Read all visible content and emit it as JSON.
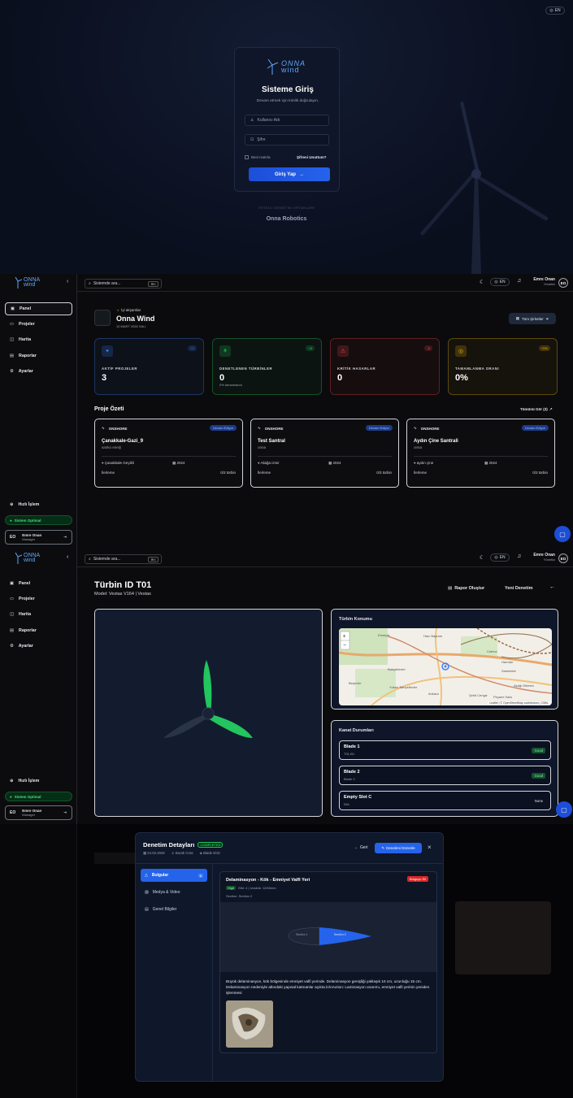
{
  "login": {
    "lang": "EN",
    "logo_line1": "ONNA",
    "logo_line2": "wind",
    "title": "Sisteme Giriş",
    "subtitle": "Devam etmek için kimlik doğrulayın.",
    "username_placeholder": "Kullanıcı Adı",
    "password_placeholder": "Şifre",
    "remember": "Beni Hatırla",
    "forgot": "Şifreni Unuttum?",
    "submit": "Giriş Yap",
    "footer_caption": "YETKİLİ DENETİM ORTAKLARI",
    "footer_brand": "Onna Robotics"
  },
  "shell": {
    "logo_line1": "ONNA",
    "logo_line2": "wind",
    "search_placeholder": "Sistemde ara...",
    "search_kbd": "⌘K",
    "lang": "EN",
    "user_name": "Emre Onan",
    "user_role_top": "Yönetici",
    "user_initials": "EO",
    "nav": [
      "Panel",
      "Projeler",
      "Harita",
      "Raporlar",
      "Ayarlar"
    ],
    "quick_action": "Hızlı İşlem",
    "system_status": "Sistem Optimal",
    "user_role_card": "Manager"
  },
  "dashboard": {
    "greeting": "İyi akşamlar",
    "company": "Onna Wind",
    "date": "10 MART 2026 SALI",
    "company_filter": "Tüm Şirketler",
    "stats": [
      {
        "label": "AKTİF PROJELER",
        "value": "3",
        "badge": "+1",
        "sub": "",
        "color": "#3b82f6"
      },
      {
        "label": "DENETLENEN TÜRBİNLER",
        "value": "0",
        "badge": "+8",
        "sub": "0% tamamlandı",
        "color": "#22c55e"
      },
      {
        "label": "KRİTİK HASARLAR",
        "value": "0",
        "badge": "-8",
        "sub": "",
        "color": "#ef4444"
      },
      {
        "label": "TAMAMLANMA ORANI",
        "value": "0%",
        "badge": "+0%",
        "sub": "",
        "color": "#eab308"
      }
    ],
    "section_title": "Proje Özeti",
    "view_all": "Tümünü Gör (3)",
    "projects": [
      {
        "type": "ONSHORE",
        "status": "Devam Ediyor",
        "name": "Çanakkale-Gazi_9",
        "company": "sanko enerji",
        "location": "Çanakkale Geyikli",
        "year": "2024",
        "progress_label": "İlerleme",
        "turbines": "0/3 türbin"
      },
      {
        "type": "ONSHORE",
        "status": "Devam Ediyor",
        "name": "Test Santral",
        "company": "onna",
        "location": "Aliağa izmir",
        "year": "2024",
        "progress_label": "İlerleme",
        "turbines": "0/3 türbin"
      },
      {
        "type": "ONSHORE",
        "status": "Devam Ediyor",
        "name": "Aydın Çine Santrali",
        "company": "onna",
        "location": "aydın çine",
        "year": "2024",
        "progress_label": "İlerleme",
        "turbines": "0/3 türbin"
      }
    ]
  },
  "turbine": {
    "title": "Türbin ID T01",
    "model": "Model: Vestas V164 | Vestas",
    "report_btn": "Rapor Oluştur",
    "new_btn": "Yeni Denetim",
    "location_title": "Türbin Konumu",
    "map_attribution": "Leaflet | © OpenStreetMap contributors | ODbL",
    "map_labels": [
      "Emniyet",
      "Hacı Bayram",
      "Cebeci",
      "Bahçelievler",
      "Yukarı Bahçelievler",
      "Beşevler",
      "Harman",
      "Samkelelr",
      "Ankara",
      "Şehit Cengiz",
      "Peyami Safa",
      "Aşağı Dikmen"
    ],
    "blades_title": "Kanat Durumları",
    "blades": [
      {
        "name": "Blade 1",
        "sub": "T01-B1",
        "status": "Good"
      },
      {
        "name": "Blade 2",
        "sub": "Blade 2",
        "status": "Good"
      },
      {
        "name": "Empty Slot C",
        "sub": "N/A",
        "status": "None"
      }
    ]
  },
  "inspection": {
    "title": "Denetim Detayları",
    "status": "COMPLETED",
    "date": "24.02.2026",
    "inspector": "Burak Cüra",
    "blade": "Blade 8/10",
    "back_btn": "Geri",
    "edit_btn": "Denetimi Düzenle",
    "tabs": [
      {
        "label": "Bulgular",
        "count": "1"
      },
      {
        "label": "Medya & Video",
        "count": ""
      },
      {
        "label": "Genel Bilgiler",
        "count": ""
      }
    ],
    "finding": {
      "title": "Delaminasyon - Kök - Emniyet Valfi Yeri",
      "delete_btn": "Bulguyu Sil",
      "severity": "High",
      "meta": "Etki: 4 | Uzaklık: 12/60mm",
      "section": "Section: Section 2",
      "section1_label": "Section 1",
      "section2_label": "Section 2",
      "description": "Büyük delaminasyon, kök bölgesinde emniyet valfi yerinde. Delaminasyon genişliği yaklaşık 10 cm, uzunluğu 15 cm. Delaminasyon nedeniyle altındaki yapısal katmanlar açıkta.\\n\\nAction: Laminasyon onarımı, emniyet valfi yerinin yeniden işlenmesi"
    }
  }
}
